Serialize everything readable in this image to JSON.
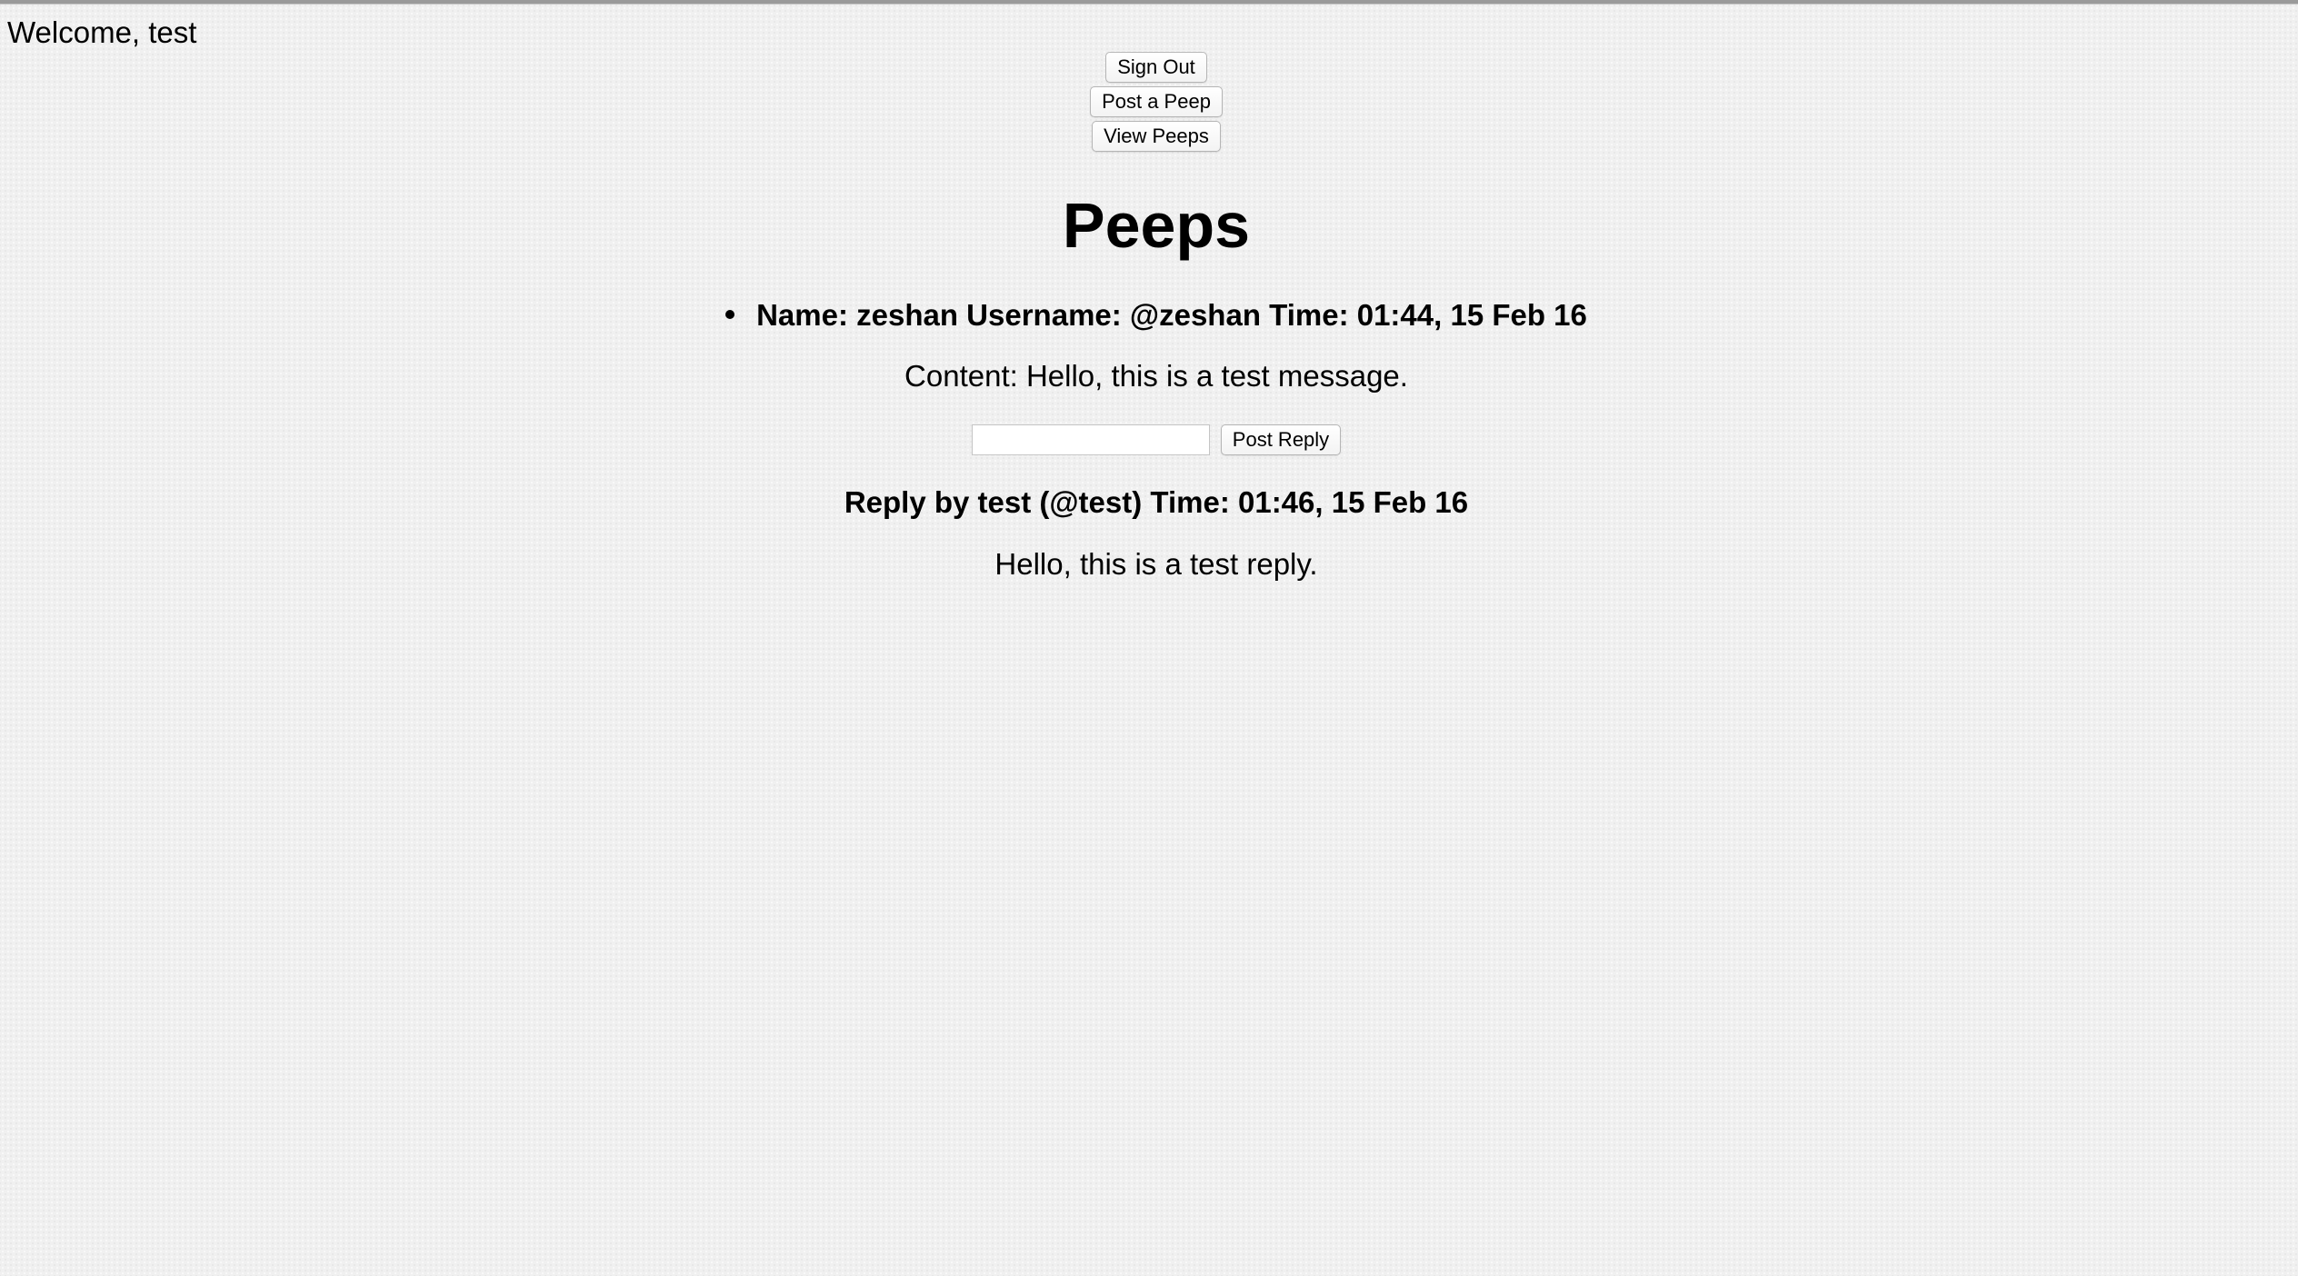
{
  "header": {
    "welcome": "Welcome, test"
  },
  "nav": {
    "sign_out": "Sign Out",
    "post_peep": "Post a Peep",
    "view_peeps": "View Peeps"
  },
  "page": {
    "title": "Peeps"
  },
  "peeps": [
    {
      "header": "Name: zeshan Username: @zeshan Time: 01:44, 15 Feb 16",
      "content": "Content: Hello, this is a test message.",
      "reply_input_value": "",
      "reply_button": "Post Reply",
      "replies": [
        {
          "header": "Reply by test (@test) Time: 01:46, 15 Feb 16",
          "body": "Hello, this is a test reply."
        }
      ]
    }
  ]
}
